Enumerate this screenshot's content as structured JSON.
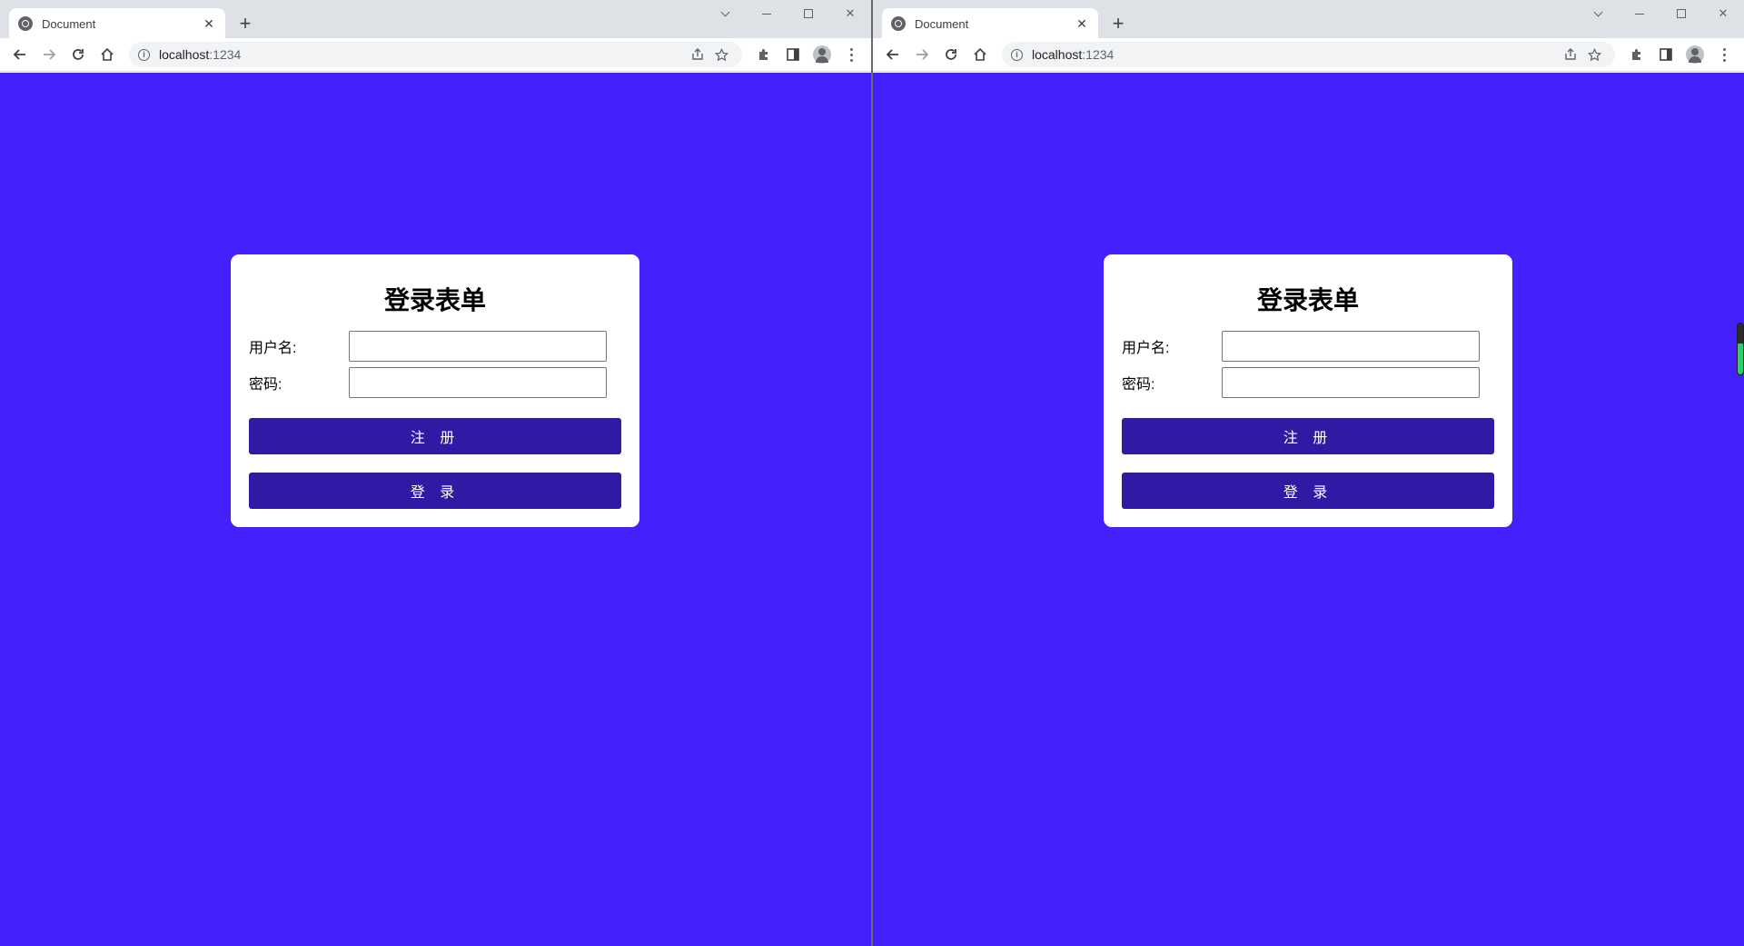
{
  "windows": [
    {
      "tab_title": "Document",
      "url_host": "localhost",
      "url_port": ":1234",
      "form": {
        "title": "登录表单",
        "username_label": "用户名:",
        "username_value": "",
        "password_label": "密码:",
        "password_value": "",
        "register_label": "注 册",
        "login_label": "登 录"
      }
    },
    {
      "tab_title": "Document",
      "url_host": "localhost",
      "url_port": ":1234",
      "form": {
        "title": "登录表单",
        "username_label": "用户名:",
        "username_value": "",
        "password_label": "密码:",
        "password_value": "",
        "register_label": "注 册",
        "login_label": "登 录"
      }
    }
  ],
  "colors": {
    "page_background": "#4321fc",
    "button_background": "#2e1aa3",
    "card_background": "#ffffff"
  },
  "icons": {
    "back": "arrow-left-icon",
    "forward": "arrow-right-icon",
    "reload": "reload-icon",
    "home": "home-icon",
    "share": "share-icon",
    "bookmark": "star-icon",
    "extensions": "puzzle-icon",
    "side_panel": "side-panel-icon",
    "profile": "profile-icon",
    "menu": "kebab-menu-icon"
  }
}
